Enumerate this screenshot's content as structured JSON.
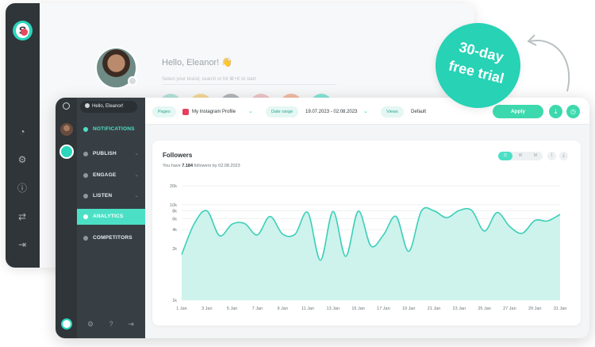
{
  "greeting": "Hello, Eleanor! 👋",
  "search_hint": "Select your brand, search or hit ⌘+K to start",
  "promo": {
    "line1": "30-day",
    "line2": "free trial"
  },
  "user_pill": "Hello, Eleanor!",
  "nav": {
    "notifications": "NOTIFICATIONS",
    "publish": "PUBLISH",
    "engage": "ENGAGE",
    "listen": "LISTEN",
    "analytics": "ANALYTICS",
    "competitors": "COMPETITORS"
  },
  "filters": {
    "pages_label": "Pages",
    "page_value": "My Instagram Profile",
    "date_label": "Date range",
    "date_value": "19.07.2023 - 02.08.2023",
    "views_label": "Views",
    "views_value": "Default",
    "apply": "Apply"
  },
  "card": {
    "title": "Followers",
    "sub_prefix": "You have",
    "sub_count": "7.184",
    "sub_suffix": "followers by 02.08.2023",
    "toggle": [
      "D",
      "W",
      "M"
    ]
  },
  "colors": {
    "accent": "#4be0c6",
    "promo": "#27d2b5",
    "area_fill": "#cdf3ec",
    "line": "#3ccfb8"
  },
  "chart_data": {
    "type": "area",
    "title": "Followers",
    "yscale": "log",
    "ylim": [
      1,
      20000
    ],
    "yticks": [
      {
        "v": 1,
        "label": "1k"
      },
      {
        "v": 2000,
        "label": "2k"
      },
      {
        "v": 4000,
        "label": "4k"
      },
      {
        "v": 6000,
        "label": "6k"
      },
      {
        "v": 8000,
        "label": "8k"
      },
      {
        "v": 10000,
        "label": "10k"
      },
      {
        "v": 20000,
        "label": "20k"
      }
    ],
    "xtick_labels": [
      "1 Jan",
      "3 Jan",
      "5 Jan",
      "7 Jan",
      "9 Jan",
      "11 Jan",
      "13 Jan",
      "15 Jan",
      "17 Jan",
      "19 Jan",
      "21 Jan",
      "23 Jan",
      "25 Jan",
      "27 Jan",
      "29 Jan",
      "31 Jan"
    ],
    "x": [
      1,
      2,
      3,
      4,
      5,
      6,
      7,
      8,
      9,
      10,
      11,
      12,
      13,
      14,
      15,
      16,
      17,
      18,
      19,
      20,
      21,
      22,
      23,
      24,
      25,
      26,
      27,
      28,
      29,
      30,
      31
    ],
    "values": [
      1600,
      5000,
      8000,
      3200,
      4900,
      5000,
      3300,
      6500,
      3400,
      3400,
      7500,
      1300,
      7800,
      1500,
      7900,
      2200,
      3300,
      6500,
      1800,
      7900,
      8000,
      6200,
      8100,
      8100,
      3800,
      7500,
      4500,
      3500,
      5600,
      5500,
      7000
    ],
    "grid": true
  }
}
